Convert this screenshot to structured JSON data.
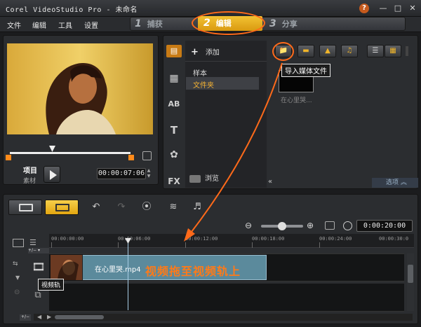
{
  "window": {
    "title": "Corel VideoStudio Pro - 未命名",
    "help_label": "?",
    "minimize_label": "—",
    "maximize_label": "□",
    "close_label": "✕"
  },
  "menu": {
    "items": [
      "文件",
      "编辑",
      "工具",
      "设置"
    ]
  },
  "steps": [
    {
      "num": "1",
      "label": "捕获"
    },
    {
      "num": "2",
      "label": "编辑",
      "active": true
    },
    {
      "num": "3",
      "label": "分享"
    }
  ],
  "preview": {
    "mode_project": "项目",
    "mode_clip": "素材",
    "timecode": "00:00:07:06"
  },
  "library": {
    "add_label": "添加",
    "folders": [
      "样本",
      "文件夹"
    ],
    "browse_label": "浏览",
    "import_tooltip": "导入媒体文件",
    "thumbnail_label": "在心里哭...",
    "options_label": "选项"
  },
  "timeline": {
    "duration": "0:00:20:00",
    "ruler_labels": [
      "00:00:00:00",
      "00:00:06:00",
      "00:00:12:00",
      "00:00:18:00",
      "00:00:24:00",
      "00:00:30:0"
    ],
    "clip_name": "在心里哭.mp4",
    "video_track_tip": "视频轨",
    "annotation": "视频拖至视频轨上"
  },
  "colors": {
    "accent_orange": "#ff6a1a",
    "active_step": "#f3c233",
    "clip_fill": "#5b8a9c"
  },
  "icons": {
    "library_sidebar": [
      "media-icon",
      "transition-icon",
      "title-icon",
      "text-icon",
      "graphic-icon",
      "filter-icon"
    ],
    "library_sidebar_glyphs": [
      "▤",
      "▦",
      "AB",
      "T",
      "✿",
      "FX"
    ]
  }
}
